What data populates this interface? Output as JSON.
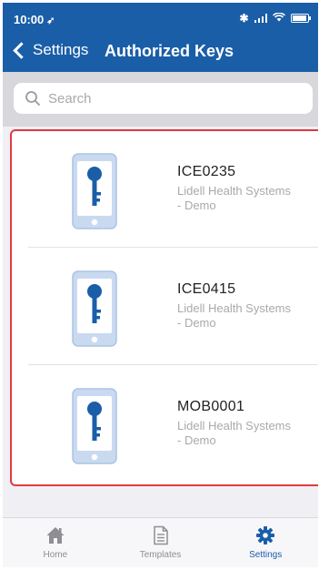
{
  "status_bar": {
    "time": "10:00",
    "location_glyph": "➶"
  },
  "navbar": {
    "back_label": "Settings",
    "title": "Authorized Keys"
  },
  "search": {
    "placeholder": "Search"
  },
  "keys": [
    {
      "id": "ICE0235",
      "org_line1": "Lidell Health Systems",
      "org_line2": "- Demo"
    },
    {
      "id": "ICE0415",
      "org_line1": "Lidell Health Systems",
      "org_line2": "- Demo"
    },
    {
      "id": "MOB0001",
      "org_line1": "Lidell Health Systems",
      "org_line2": "- Demo"
    }
  ],
  "tabs": [
    {
      "label": "Home",
      "icon": "home-icon",
      "active": false
    },
    {
      "label": "Templates",
      "icon": "document-icon",
      "active": false
    },
    {
      "label": "Settings",
      "icon": "gear-icon",
      "active": true
    }
  ],
  "colors": {
    "brand_blue": "#1a5ea8",
    "selection_border": "#e03a3f",
    "phone_fill": "#c9daf0",
    "key_color": "#1a5ea8"
  }
}
